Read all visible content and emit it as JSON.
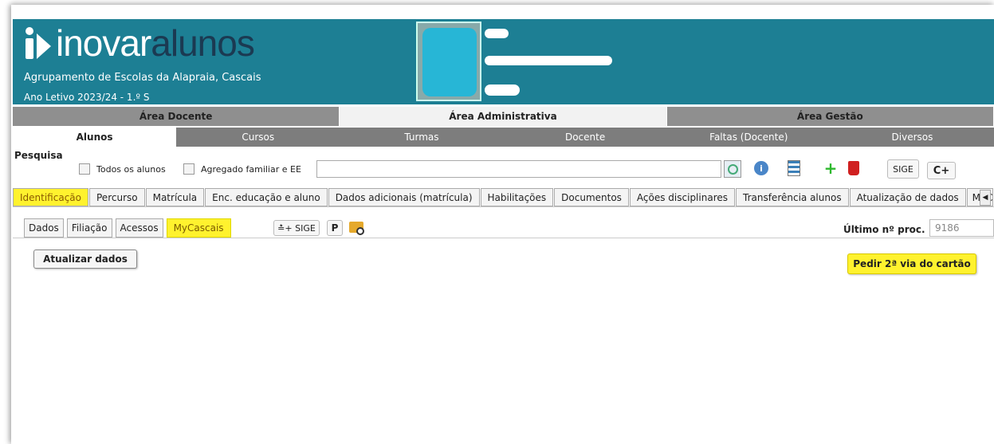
{
  "header": {
    "logo_prefix": "inovar",
    "logo_suffix": "alunos",
    "school": "Agrupamento de Escolas da Alapraia, Cascais",
    "school_year": "Ano Letivo 2023/24 - 1.º S",
    "bg_color": "#1d7f94"
  },
  "area_tabs": [
    {
      "label": "Área Docente"
    },
    {
      "label": "Área Administrativa"
    },
    {
      "label": "Área Gestão"
    }
  ],
  "module_tabs": [
    {
      "label": "Alunos"
    },
    {
      "label": "Cursos"
    },
    {
      "label": "Turmas"
    },
    {
      "label": "Docente"
    },
    {
      "label": "Faltas (Docente)"
    },
    {
      "label": "Diversos"
    }
  ],
  "search": {
    "label": "Pesquisa",
    "all_students": "Todos os alunos",
    "household": "Agregado familiar e EE",
    "value": "",
    "sige_label": "SIGE",
    "cplus_label": "C+"
  },
  "sub_tabs": [
    {
      "label": "Identificação"
    },
    {
      "label": "Percurso"
    },
    {
      "label": "Matrícula"
    },
    {
      "label": "Enc. educação e aluno"
    },
    {
      "label": "Dados adicionais (matrícula)"
    },
    {
      "label": "Habilitações"
    },
    {
      "label": "Documentos"
    },
    {
      "label": "Ações disciplinares"
    },
    {
      "label": "Transferência alunos"
    },
    {
      "label": "Atualização de dados"
    },
    {
      "label": "MyCas"
    }
  ],
  "inner_tabs": [
    {
      "label": "Dados"
    },
    {
      "label": "Filiação"
    },
    {
      "label": "Acessos"
    },
    {
      "label": "MyCascais"
    }
  ],
  "toolbar": {
    "add_sige": "≛+ SIGE",
    "p": "P"
  },
  "ultimo": {
    "label": "Último nº proc.",
    "value": "9186"
  },
  "actions": {
    "update": "Atualizar dados",
    "request_card": "Pedir 2ª via do cartão"
  },
  "highlight_color": "#fff22e"
}
